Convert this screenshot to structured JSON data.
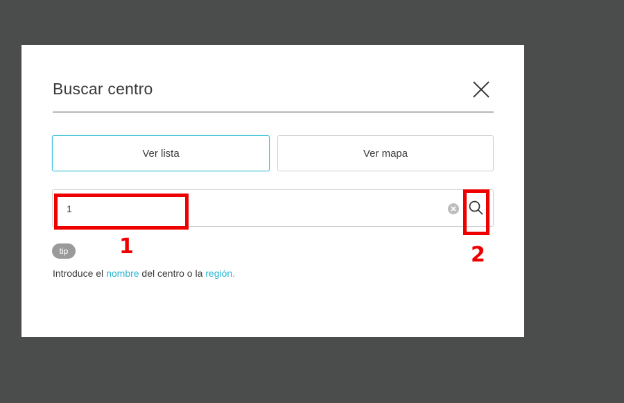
{
  "modal": {
    "title": "Buscar centro",
    "close_icon": "close-icon"
  },
  "tabs": [
    {
      "label": "Ver lista",
      "active": true
    },
    {
      "label": "Ver mapa",
      "active": false
    }
  ],
  "search": {
    "value": "1",
    "clear_icon": "clear-circle-icon",
    "search_icon": "magnifier-icon"
  },
  "tip": {
    "badge": "tip",
    "text_before": "Introduce el ",
    "link_name": "nombre",
    "text_middle": " del centro o la ",
    "link_region": "región."
  },
  "annotations": {
    "label_1": "1",
    "label_2": "2"
  },
  "colors": {
    "overlay": "#4b4c4c",
    "accent": "#3cc1d6",
    "link": "#28b4d3",
    "annotation": "#ee0000"
  }
}
